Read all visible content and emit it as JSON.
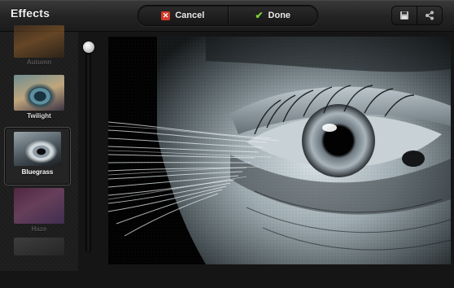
{
  "header": {
    "title": "Effects",
    "cancel_label": "Cancel",
    "done_label": "Done"
  },
  "effects": [
    {
      "label": "Autumn",
      "selected": false
    },
    {
      "label": "Twilight",
      "selected": false
    },
    {
      "label": "Bluegrass",
      "selected": true
    },
    {
      "label": "Haze",
      "selected": false
    }
  ],
  "intensity": 1.0,
  "colors": {
    "cancel_icon": "#d23a2a",
    "done_icon": "#7fcf3a"
  },
  "icons": {
    "cancel": "close-icon",
    "done": "check-icon",
    "save": "save-icon",
    "share": "share-icon"
  }
}
